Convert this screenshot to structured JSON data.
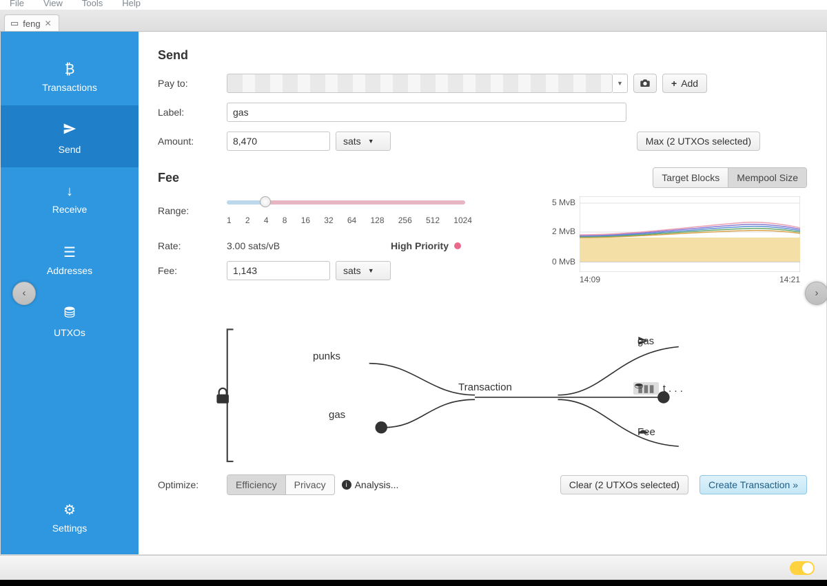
{
  "menubar": [
    "File",
    "View",
    "Tools",
    "Help"
  ],
  "tab": {
    "name": "feng"
  },
  "sidebar": {
    "items": [
      {
        "label": "Transactions"
      },
      {
        "label": "Send"
      },
      {
        "label": "Receive"
      },
      {
        "label": "Addresses"
      },
      {
        "label": "UTXOs"
      },
      {
        "label": "Settings"
      }
    ]
  },
  "send": {
    "heading": "Send",
    "pay_to_label": "Pay to:",
    "add_button": "+ Add",
    "label_label": "Label:",
    "label_value": "gas",
    "amount_label": "Amount:",
    "amount_value": "8,470",
    "amount_unit": "sats",
    "max_button": "Max (2 UTXOs selected)"
  },
  "fee": {
    "heading": "Fee",
    "tab_target": "Target Blocks",
    "tab_mempool": "Mempool Size",
    "range_label": "Range:",
    "range_ticks": [
      "1",
      "2",
      "4",
      "8",
      "16",
      "32",
      "64",
      "128",
      "256",
      "512",
      "1024"
    ],
    "rate_label": "Rate:",
    "rate_value": "3.00 sats/vB",
    "priority_label": "High Priority",
    "fee_label": "Fee:",
    "fee_value": "1,143",
    "fee_unit": "sats"
  },
  "chart_data": {
    "type": "area",
    "ylabel": "MvB",
    "y_ticks": [
      "5 MvB",
      "2 MvB",
      "0 MvB"
    ],
    "x_ticks": [
      "14:09",
      "14:21"
    ],
    "series": [
      {
        "name": "band1",
        "color": "#ec9fb3"
      },
      {
        "name": "band2",
        "color": "#8a7ad3"
      },
      {
        "name": "band3",
        "color": "#5a8fd4"
      },
      {
        "name": "band4",
        "color": "#63a86b"
      },
      {
        "name": "band5",
        "color": "#d6b04b"
      },
      {
        "name": "fill",
        "color": "#f4dfa6"
      }
    ],
    "approx_top_mvb": 3.0
  },
  "diagram": {
    "input1": "punks",
    "input2": "gas",
    "tx_label": "Transaction",
    "out1": "gas",
    "out2": "t . . .",
    "out3": "Fee"
  },
  "optimize": {
    "label": "Optimize:",
    "efficiency": "Efficiency",
    "privacy": "Privacy",
    "analysis": "Analysis..."
  },
  "actions": {
    "clear": "Clear (2 UTXOs selected)",
    "create": "Create Transaction »"
  }
}
